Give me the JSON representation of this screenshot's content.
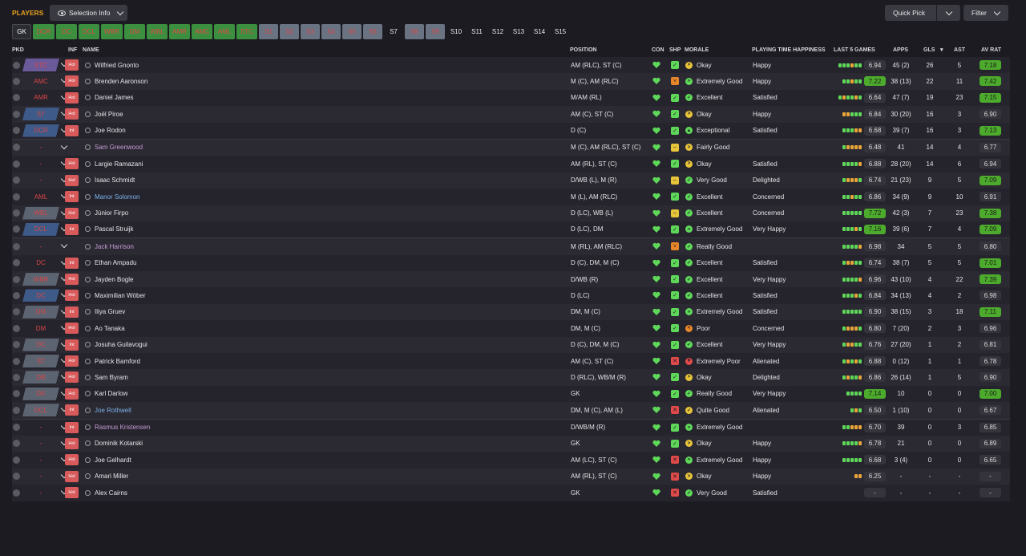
{
  "header": {
    "title": "PLAYERS",
    "selection_info": "Selection Info",
    "quick_pick": "Quick Pick",
    "filter": "Filter"
  },
  "positions": [
    {
      "label": "GK",
      "style": "gk",
      "w": 24
    },
    {
      "label": "DCR",
      "style": "g",
      "w": 27
    },
    {
      "label": "DC",
      "style": "g",
      "w": 26
    },
    {
      "label": "DCL",
      "style": "g",
      "w": 26
    },
    {
      "label": "WBR",
      "style": "g",
      "w": 27
    },
    {
      "label": "DM",
      "style": "g",
      "w": 26
    },
    {
      "label": "WBL",
      "style": "g",
      "w": 26
    },
    {
      "label": "AMR",
      "style": "g",
      "w": 26
    },
    {
      "label": "AMC",
      "style": "g",
      "w": 26
    },
    {
      "label": "AML",
      "style": "g",
      "w": 26
    },
    {
      "label": "STC",
      "style": "g",
      "w": 26
    },
    {
      "label": "S1",
      "style": "grey",
      "w": 24
    },
    {
      "label": "S2",
      "style": "grey",
      "w": 24
    },
    {
      "label": "S3",
      "style": "grey",
      "w": 24
    },
    {
      "label": "S4",
      "style": "grey",
      "w": 24
    },
    {
      "label": "S5",
      "style": "grey",
      "w": 24
    },
    {
      "label": "S6",
      "style": "grey",
      "w": 24
    },
    {
      "label": "S7",
      "style": "plain",
      "w": 24
    },
    {
      "label": "S8",
      "style": "grey",
      "w": 24
    },
    {
      "label": "S9",
      "style": "grey",
      "w": 24
    },
    {
      "label": "S10",
      "style": "plain",
      "w": 24
    },
    {
      "label": "S11",
      "style": "plain",
      "w": 24
    },
    {
      "label": "S12",
      "style": "plain",
      "w": 24
    },
    {
      "label": "S13",
      "style": "plain",
      "w": 24
    },
    {
      "label": "S14",
      "style": "plain",
      "w": 24
    },
    {
      "label": "S15",
      "style": "plain",
      "w": 24
    }
  ],
  "columns": {
    "pkd": "PKD",
    "inf": "INF",
    "name": "NAME",
    "position": "POSITION",
    "con": "CON",
    "shp": "SHP",
    "morale": "MORALE",
    "pth": "PLAYING TIME HAPPINESS",
    "last5": "LAST 5 GAMES",
    "apps": "APPS",
    "gls": "GLS",
    "ast": "AST",
    "avrat": "AV RAT"
  },
  "colors": {
    "green": "#5fd85a",
    "yellow": "#e8c43a",
    "orange": "#e8872a",
    "red": "#e04a4a"
  },
  "players": [
    {
      "pkd": "STC",
      "pkdStyle": "purple",
      "inf": "Hol",
      "name": "Wilfried Gnonto",
      "nameColor": "#e4e4e8",
      "position": "AM (RLC), ST (C)",
      "shp": "green",
      "mc": "#e8c43a",
      "mg": ">",
      "morale": "Okay",
      "pth": "Happy",
      "bars": "gggogg",
      "l5": "6.94",
      "l5g": false,
      "apps": "45 (2)",
      "gls": "26",
      "ast": "5",
      "avr": "7.18",
      "avg": true
    },
    {
      "pkd": "AMC",
      "pkdStyle": "dark",
      "inf": "Hol",
      "name": "Brenden Aaronson",
      "nameColor": "#e4e4e8",
      "position": "M (C), AM (RLC)",
      "shp": "orange",
      "mc": "#5fd85a",
      "mg": "»",
      "morale": "Extremely Good",
      "pth": "Happy",
      "bars": "ggogg",
      "l5": "7.22",
      "l5g": true,
      "apps": "38 (13)",
      "gls": "22",
      "ast": "11",
      "avr": "7.42",
      "avg": true
    },
    {
      "pkd": "AMR",
      "pkdStyle": "dark",
      "inf": "Hol",
      "name": "Daniel James",
      "nameColor": "#e4e4e8",
      "position": "M/AM (RL)",
      "shp": "green",
      "mc": "#5fd85a",
      "mg": "✓",
      "morale": "Excellent",
      "pth": "Satisfied",
      "bars": "goggog",
      "l5": "6.64",
      "l5g": false,
      "apps": "47 (7)",
      "gls": "19",
      "ast": "23",
      "avr": "7.15",
      "avg": true
    },
    {
      "pkd": "ST",
      "pkdStyle": "blue",
      "inf": "Hol",
      "name": "Joël Piroe",
      "nameColor": "#e4e4e8",
      "position": "AM (C), ST (C)",
      "shp": "green",
      "mc": "#e8c43a",
      "mg": ">",
      "morale": "Okay",
      "pth": "Happy",
      "bars": "ooggg",
      "l5": "6.84",
      "l5g": false,
      "apps": "30 (20)",
      "gls": "16",
      "ast": "3",
      "avr": "6.90",
      "avg": false
    },
    {
      "pkd": "DCR",
      "pkdStyle": "blue",
      "inf": "Int",
      "name": "Joe Rodon",
      "nameColor": "#e4e4e8",
      "position": "D (C)",
      "shp": "green",
      "mc": "#5fd85a",
      "mg": "▲",
      "morale": "Exceptional",
      "pth": "Satisfied",
      "bars": "gggoo",
      "l5": "6.68",
      "l5g": false,
      "apps": "39 (7)",
      "gls": "16",
      "ast": "3",
      "avr": "7.13",
      "avg": true
    },
    {
      "pkd": "-",
      "pkdStyle": "dark",
      "inf": "",
      "name": "Sam Greenwood",
      "nameColor": "#c79cd6",
      "position": "M (C), AM (RLC), ST (C)",
      "shp": "yellow",
      "mc": "#e8c43a",
      "mg": ">",
      "morale": "Fairly Good",
      "pth": "",
      "bars": "goooo",
      "l5": "6.48",
      "l5g": false,
      "apps": "41",
      "gls": "14",
      "ast": "4",
      "avr": "6.77",
      "avg": false
    },
    {
      "pkd": "-",
      "pkdStyle": "dark",
      "inf": "Hol",
      "name": "Largie Ramazani",
      "nameColor": "#e4e4e8",
      "position": "AM (RL), ST (C)",
      "shp": "green",
      "mc": "#e8c43a",
      "mg": ">",
      "morale": "Okay",
      "pth": "Satisfied",
      "bars": "ggggo",
      "l5": "6.88",
      "l5g": false,
      "apps": "28 (20)",
      "gls": "14",
      "ast": "6",
      "avr": "6.94",
      "avg": false
    },
    {
      "pkd": "-",
      "pkdStyle": "dark",
      "inf": "Hol",
      "name": "Isaac Schmidt",
      "nameColor": "#e4e4e8",
      "position": "D/WB (L), M (R)",
      "shp": "yellow",
      "mc": "#5fd85a",
      "mg": "✓",
      "morale": "Very Good",
      "pth": "Delighted",
      "bars": "gooog",
      "l5": "6.74",
      "l5g": false,
      "apps": "21 (23)",
      "gls": "9",
      "ast": "5",
      "avr": "7.09",
      "avg": true
    },
    {
      "pkd": "AML",
      "pkdStyle": "dark",
      "inf": "Int",
      "name": "Manor Solomon",
      "nameColor": "#7bb0ea",
      "position": "M (L), AM (RLC)",
      "shp": "green",
      "mc": "#5fd85a",
      "mg": "✓",
      "morale": "Excellent",
      "pth": "Concerned",
      "bars": "ggogg",
      "l5": "6.86",
      "l5g": false,
      "apps": "34 (9)",
      "gls": "9",
      "ast": "10",
      "avr": "6.91",
      "avg": false
    },
    {
      "pkd": "WBL",
      "pkdStyle": "grey",
      "inf": "Hol",
      "name": "Júnior Firpo",
      "nameColor": "#e4e4e8",
      "position": "D (LC), WB (L)",
      "shp": "yellow",
      "mc": "#5fd85a",
      "mg": "✓",
      "morale": "Excellent",
      "pth": "Concerned",
      "bars": "ggggg",
      "l5": "7.72",
      "l5g": true,
      "apps": "42 (3)",
      "gls": "7",
      "ast": "23",
      "avr": "7.38",
      "avg": true
    },
    {
      "pkd": "DCL",
      "pkdStyle": "blue",
      "inf": "Int",
      "name": "Pascal Struijk",
      "nameColor": "#e4e4e8",
      "position": "D (LC), DM",
      "shp": "green",
      "mc": "#5fd85a",
      "mg": "»",
      "morale": "Extremely Good",
      "pth": "Very Happy",
      "bars": "gggog",
      "l5": "7.16",
      "l5g": true,
      "apps": "39 (6)",
      "gls": "7",
      "ast": "4",
      "avr": "7.09",
      "avg": true
    },
    {
      "pkd": "-",
      "pkdStyle": "dark",
      "inf": "",
      "name": "Jack Harrison",
      "nameColor": "#c79cd6",
      "position": "M (RL), AM (RLC)",
      "shp": "orange",
      "mc": "#5fd85a",
      "mg": "✓",
      "morale": "Really Good",
      "pth": "",
      "bars": "ggggo",
      "l5": "6.98",
      "l5g": false,
      "apps": "34",
      "gls": "5",
      "ast": "5",
      "avr": "6.80",
      "avg": false
    },
    {
      "pkd": "DC",
      "pkdStyle": "dark",
      "inf": "Int",
      "name": "Ethan Ampadu",
      "nameColor": "#e4e4e8",
      "position": "D (C), DM, M (C)",
      "shp": "green",
      "mc": "#5fd85a",
      "mg": "✓",
      "morale": "Excellent",
      "pth": "Satisfied",
      "bars": "googg",
      "l5": "6.74",
      "l5g": false,
      "apps": "38 (7)",
      "gls": "5",
      "ast": "5",
      "avr": "7.01",
      "avg": true
    },
    {
      "pkd": "WBR",
      "pkdStyle": "grey",
      "inf": "Hol",
      "name": "Jayden Bogle",
      "nameColor": "#e4e4e8",
      "position": "D/WB (R)",
      "shp": "green",
      "mc": "#5fd85a",
      "mg": "✓",
      "morale": "Excellent",
      "pth": "Very Happy",
      "bars": "ggggo",
      "l5": "6.96",
      "l5g": false,
      "apps": "43 (10)",
      "gls": "4",
      "ast": "22",
      "avr": "7.39",
      "avg": true
    },
    {
      "pkd": "DC",
      "pkdStyle": "blue",
      "inf": "Hol",
      "name": "Maximilian Wöber",
      "nameColor": "#e4e4e8",
      "position": "D (LC)",
      "shp": "green",
      "mc": "#5fd85a",
      "mg": "✓",
      "morale": "Excellent",
      "pth": "Satisfied",
      "bars": "gggog",
      "l5": "6.84",
      "l5g": false,
      "apps": "34 (13)",
      "gls": "4",
      "ast": "2",
      "avr": "6.98",
      "avg": false
    },
    {
      "pkd": "DM",
      "pkdStyle": "grey",
      "inf": "Int",
      "name": "Iliya Gruev",
      "nameColor": "#e4e4e8",
      "position": "DM, M (C)",
      "shp": "green",
      "mc": "#5fd85a",
      "mg": "»",
      "morale": "Extremely Good",
      "pth": "Satisfied",
      "bars": "ggggg",
      "l5": "6.90",
      "l5g": false,
      "apps": "38 (15)",
      "gls": "3",
      "ast": "18",
      "avr": "7.11",
      "avg": true
    },
    {
      "pkd": "DM",
      "pkdStyle": "dark",
      "inf": "Hol",
      "name": "Ao Tanaka",
      "nameColor": "#e4e4e8",
      "position": "DM, M (C)",
      "shp": "green",
      "mc": "#e8872a",
      "mg": "<",
      "morale": "Poor",
      "pth": "Concerned",
      "bars": "gooog",
      "l5": "6.80",
      "l5g": false,
      "apps": "7 (20)",
      "gls": "2",
      "ast": "3",
      "avr": "6.96",
      "avg": false
    },
    {
      "pkd": "DC",
      "pkdStyle": "grey",
      "inf": "Int",
      "name": "Josuha Guilavogui",
      "nameColor": "#e4e4e8",
      "position": "D (C), DM, M (C)",
      "shp": "green",
      "mc": "#5fd85a",
      "mg": "✓",
      "morale": "Excellent",
      "pth": "Very Happy",
      "bars": "googg",
      "l5": "6.76",
      "l5g": false,
      "apps": "27 (20)",
      "gls": "1",
      "ast": "2",
      "avr": "6.81",
      "avg": false
    },
    {
      "pkd": "ST",
      "pkdStyle": "grey",
      "inf": "Hol",
      "name": "Patrick Bamford",
      "nameColor": "#e4e4e8",
      "position": "AM (C), ST (C)",
      "shp": "red",
      "mc": "#e04a4a",
      "mg": "▼",
      "morale": "Extremely Poor",
      "pth": "Alienated",
      "bars": "gogog",
      "l5": "6.88",
      "l5g": false,
      "apps": "0 (12)",
      "gls": "1",
      "ast": "1",
      "avr": "6.78",
      "avg": false
    },
    {
      "pkd": "DR",
      "pkdStyle": "grey",
      "inf": "Hol",
      "name": "Sam Byram",
      "nameColor": "#e4e4e8",
      "position": "D (RLC), WB/M (R)",
      "shp": "green",
      "mc": "#e8c43a",
      "mg": ">",
      "morale": "Okay",
      "pth": "Delighted",
      "bars": "goggo",
      "l5": "6.86",
      "l5g": false,
      "apps": "26 (14)",
      "gls": "1",
      "ast": "5",
      "avr": "6.90",
      "avg": false
    },
    {
      "pkd": "GK",
      "pkdStyle": "grey",
      "inf": "Hol",
      "name": "Karl Darlow",
      "nameColor": "#e4e4e8",
      "position": "GK",
      "shp": "green",
      "mc": "#5fd85a",
      "mg": "✓",
      "morale": "Really Good",
      "pth": "Very Happy",
      "bars": "gggg",
      "l5": "7.14",
      "l5g": true,
      "apps": "10",
      "gls": "0",
      "ast": "0",
      "avr": "7.00",
      "avg": true
    },
    {
      "pkd": "DCL",
      "pkdStyle": "grey",
      "inf": "Int",
      "name": "Joe Rothwell",
      "nameColor": "#7bb0ea",
      "position": "DM, M (C), AM (L)",
      "shp": "red",
      "mc": "#e8c43a",
      "mg": "✓",
      "morale": "Quite Good",
      "pth": "Alienated",
      "bars": "gog",
      "l5": "6.50",
      "l5g": false,
      "apps": "1 (10)",
      "gls": "0",
      "ast": "0",
      "avr": "6.67",
      "avg": false
    },
    {
      "pkd": "-",
      "pkdStyle": "dark",
      "inf": "Int",
      "name": "Rasmus Kristensen",
      "nameColor": "#c79cd6",
      "position": "D/WB/M (R)",
      "shp": "green",
      "mc": "#5fd85a",
      "mg": "»",
      "morale": "Extremely Good",
      "pth": "",
      "bars": "ggooo",
      "l5": "6.70",
      "l5g": false,
      "apps": "39",
      "gls": "0",
      "ast": "3",
      "avr": "6.85",
      "avg": false
    },
    {
      "pkd": "-",
      "pkdStyle": "dark",
      "inf": "Hol",
      "name": "Dominik Kotarski",
      "nameColor": "#e4e4e8",
      "position": "GK",
      "shp": "green",
      "mc": "#e8c43a",
      "mg": ">",
      "morale": "Okay",
      "pth": "Happy",
      "bars": "ggggo",
      "l5": "6.78",
      "l5g": false,
      "apps": "21",
      "gls": "0",
      "ast": "0",
      "avr": "6.89",
      "avg": false
    },
    {
      "pkd": "-",
      "pkdStyle": "dark",
      "inf": "Hol",
      "name": "Joe Gelhardt",
      "nameColor": "#e4e4e8",
      "position": "AM (LC), ST (C)",
      "shp": "red",
      "mc": "#5fd85a",
      "mg": "»",
      "morale": "Extremely Good",
      "pth": "Happy",
      "bars": "ggggg",
      "l5": "6.68",
      "l5g": false,
      "apps": "3 (4)",
      "gls": "0",
      "ast": "0",
      "avr": "6.65",
      "avg": false
    },
    {
      "pkd": "-",
      "pkdStyle": "dark",
      "inf": "Hol",
      "name": "Amari Miller",
      "nameColor": "#e4e4e8",
      "position": "AM (RL), ST (C)",
      "shp": "red",
      "mc": "#e8c43a",
      "mg": ">",
      "morale": "Okay",
      "pth": "Happy",
      "bars": "oo",
      "l5": "6.25",
      "l5g": false,
      "apps": "-",
      "gls": "-",
      "ast": "-",
      "avr": "-",
      "avg": false
    },
    {
      "pkd": "-",
      "pkdStyle": "dark",
      "inf": "Hol",
      "name": "Alex Cairns",
      "nameColor": "#e4e4e8",
      "position": "GK",
      "shp": "red",
      "mc": "#5fd85a",
      "mg": "✓",
      "morale": "Very Good",
      "pth": "Satisfied",
      "bars": "",
      "l5": "-",
      "l5g": false,
      "apps": "-",
      "gls": "-",
      "ast": "-",
      "avr": "-",
      "avg": false
    }
  ]
}
